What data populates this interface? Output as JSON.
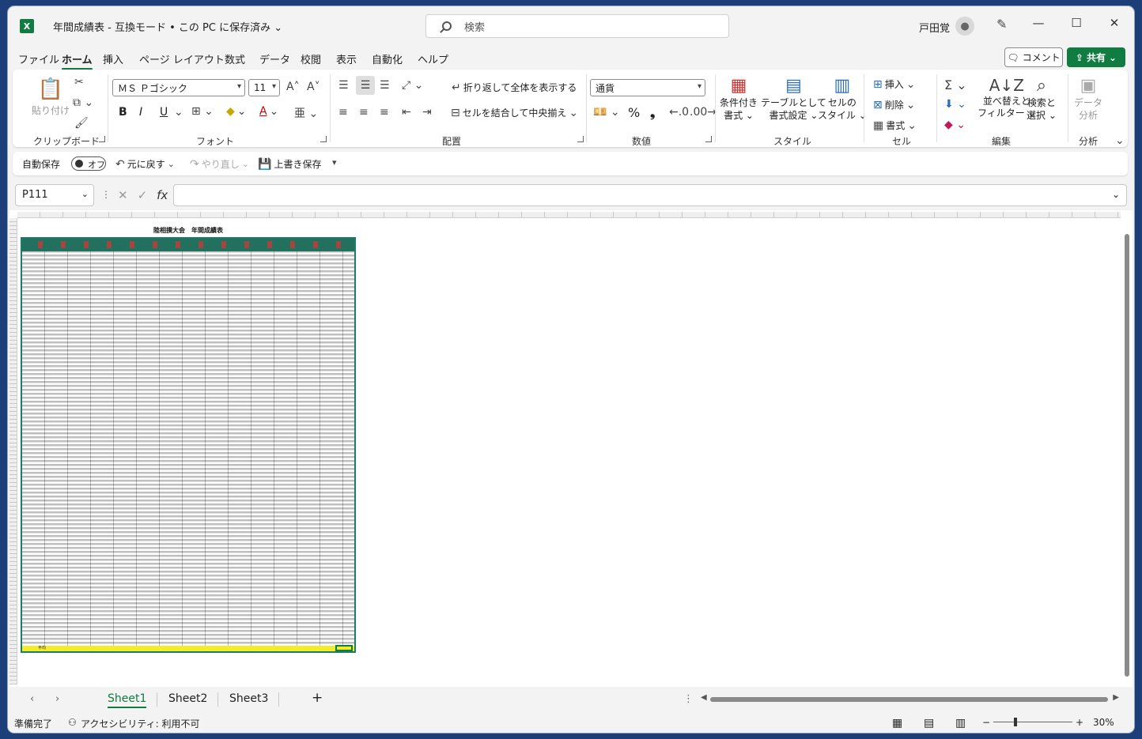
{
  "titlebar": {
    "app_logo": "X",
    "title": "年間成績表 - 互換モード • この PC に保存済み ⌄",
    "search_placeholder": "検索",
    "user_name": "戸田覚",
    "minimize": "—",
    "maximize": "☐",
    "close": "✕"
  },
  "menu": {
    "items": [
      "ファイル",
      "ホーム",
      "挿入",
      "ページ レイアウト",
      "数式",
      "データ",
      "校閲",
      "表示",
      "自動化",
      "ヘルプ"
    ],
    "active": "ホーム",
    "comment_label": "コメント",
    "share_label": "共有"
  },
  "ribbon": {
    "clipboard": {
      "paste": "貼り付け",
      "label": "クリップボード"
    },
    "font": {
      "name": "ＭＳ Ｐゴシック",
      "size": "11",
      "bold": "B",
      "italic": "I",
      "underline": "U",
      "label": "フォント"
    },
    "alignment": {
      "wrap": "折り返して全体を表示する",
      "merge": "セルを結合して中央揃え",
      "label": "配置"
    },
    "number": {
      "format": "通貨",
      "percent": "%",
      "comma": "❟",
      "label": "数値"
    },
    "styles": {
      "conditional": "条件付き",
      "conditional2": "書式 ⌄",
      "table": "テーブルとして",
      "table2": "書式設定 ⌄",
      "cell": "セルの",
      "cell2": "スタイル ⌄",
      "label": "スタイル"
    },
    "cells": {
      "insert": "挿入",
      "delete": "削除",
      "format": "書式",
      "label": "セル"
    },
    "editing": {
      "sort": "並べ替えと",
      "sort2": "フィルター ⌄",
      "find": "検索と",
      "find2": "選択 ⌄",
      "label": "編集"
    },
    "analysis": {
      "data": "データ",
      "data2": "分析",
      "label": "分析"
    }
  },
  "qab": {
    "autosave": "自動保存",
    "toggle": "オフ",
    "undo": "元に戻す",
    "redo": "やり直し",
    "save": "上書き保存"
  },
  "formula": {
    "namebox": "P111",
    "value": ""
  },
  "sheet": {
    "title": "陸相撲大会　年間成績表",
    "total_label": "平均"
  },
  "tabs": {
    "sheets": [
      "Sheet1",
      "Sheet2",
      "Sheet3"
    ],
    "active": "Sheet1",
    "add": "+"
  },
  "status": {
    "ready": "準備完了",
    "accessibility": "アクセシビリティ: 利用不可",
    "zoom": "30%"
  },
  "colors": {
    "accent": "#107c41",
    "sheet_header": "#23705f",
    "total_row": "#f2ec2c"
  }
}
